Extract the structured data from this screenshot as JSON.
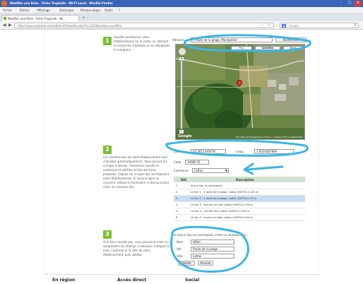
{
  "browser": {
    "window_title": "Modifier une fiche - Fiche Tropicale - Wi-Fi Local - Mozilla Firefox",
    "menu": [
      "Fichier",
      "Édition",
      "Affichage",
      "Historique",
      "Marque-pages",
      "Outils",
      "?"
    ],
    "tab_title": "Modifier une fiche - Fiche Tropicale - Wi...",
    "url": "http://www.example.com/admin/fiche/edit.php?id=1234&action=modifier",
    "search_engine": "Google"
  },
  "steps": [
    {
      "num": "1",
      "text": "Veuillez positionner votre établissement sur la carte, en utilisant la recherche d'adresse ou en déplaçant le marqueur."
    },
    {
      "num": "2",
      "text": "Les coordonnées de votre établissement sont calculées automatiquement. Vous pouvez les corriger si besoin. Choisissez ensuite la commune et vérifiez la liste des lieux proposés. Cliquez sur la ligne qui correspond à votre établissement. Si aucune ligne ne convient, utilisez le formulaire ci-dessous pour créer un nouveau lieu."
    },
    {
      "num": "3",
      "text": "Si le lieu n'existe pas, vous pouvez le créer en remplissant les champs ci-dessous. Indiquez le nom, l'adresse et la ville de votre établissement, puis validez."
    }
  ],
  "map": {
    "search_label": "Adresse",
    "address_value": "1 route de la plage, Montpellier",
    "find_button": "Rechercher",
    "map_types": [
      "Plan",
      "Satellite",
      "Mixte"
    ],
    "copyright": "Données cartographiques ©2011 - Images ©2011 DigitalGlobe",
    "google_label": "Google"
  },
  "coords": {
    "lat_label": "Lat.",
    "lat_value": "43.5612345678",
    "lon_label": "Long.",
    "lon_value": "3.9234567890",
    "code_label": "Code",
    "code_value": "34000 01",
    "commune_label": "Commune",
    "commune_value": "Lattes"
  },
  "table": {
    "headers": [
      "Réf.",
      "Description"
    ],
    "rows": [
      {
        "ref": "1",
        "desc": "Aucun lieu ne correspond",
        "selected": false
      },
      {
        "ref": "2",
        "desc": "Le lieu 1 - 3 route de la plage, Lattes (34970) à 120 m",
        "selected": false
      },
      {
        "ref": "3",
        "desc": "Le lieu 2 - 1 route de la plage, Lattes (34970) à 15 m",
        "selected": true
      },
      {
        "ref": "4",
        "desc": "Le lieu 3 - avenue du Golf, Lattes (34970) à 350 m",
        "selected": false
      },
      {
        "ref": "5",
        "desc": "Le lieu 4 - rue des Pins, Lattes (34970) à 420 m",
        "selected": false
      },
      {
        "ref": "6",
        "desc": "Le lieu 5 - chemin du Mas, Lattes (34970) à 510 m",
        "selected": false
      }
    ]
  },
  "form": {
    "intro": "Si aucun lieu ne correspond, créez un nouveau lieu :",
    "name_label": "Nom",
    "name_value": "Hôtel",
    "address_label": "Adr.",
    "address_value": "Route de la plage",
    "city_label": "Ville",
    "city_value": "Lattes",
    "submit": "Valider",
    "cancel": "Annuler"
  },
  "footer": {
    "links": [
      "En région",
      "Accès direct",
      "Social"
    ]
  },
  "colors": {
    "titlebar": "#3a64b8",
    "step_green": "#7bbf2f",
    "annotation_blue": "#39b6e8",
    "table_header": "#cfe3cf",
    "selected_row": "#c8dcf4"
  }
}
